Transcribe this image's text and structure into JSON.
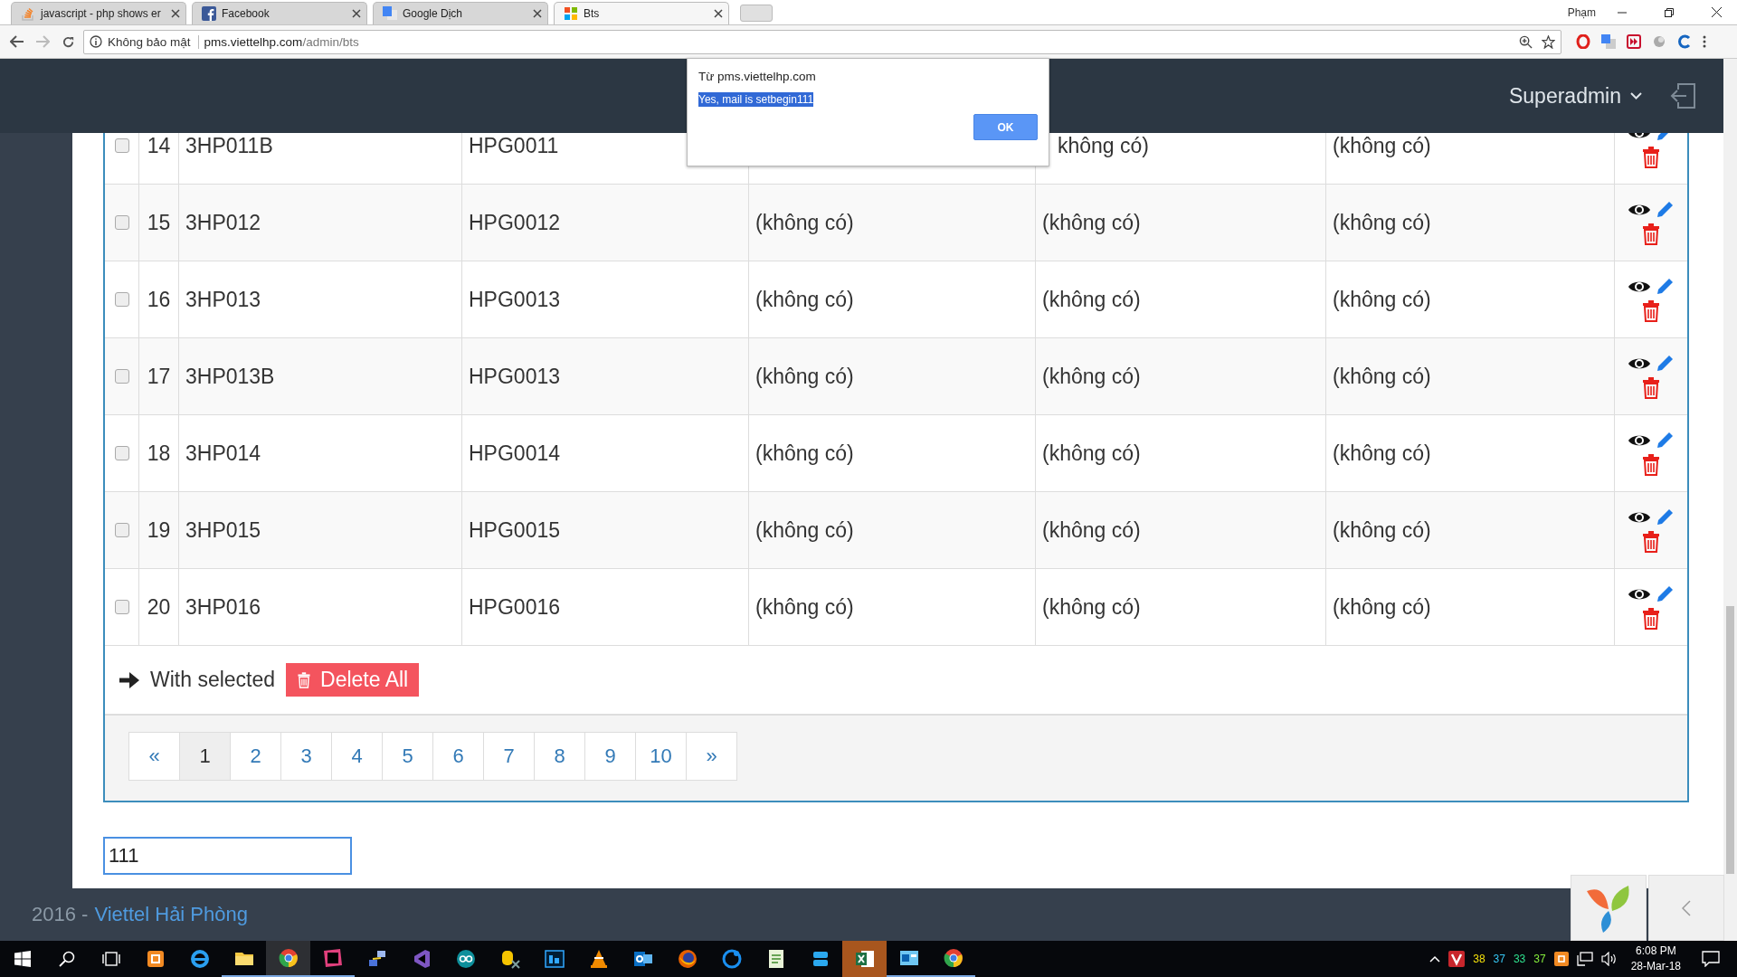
{
  "browser": {
    "tabs": [
      {
        "title": "javascript - php shows er",
        "selected": false
      },
      {
        "title": "Facebook",
        "selected": false
      },
      {
        "title": "Google Dịch",
        "selected": false
      },
      {
        "title": "Bts",
        "selected": true
      }
    ],
    "profile": "Phạm",
    "security_label": "Không bảo mật",
    "url_host": "pms.viettelhp.com",
    "url_path": "/admin/bts"
  },
  "header": {
    "user": "Superadmin"
  },
  "dialog": {
    "origin": "Từ pms.viettelhp.com",
    "message": "Yes, mail is setbegin111",
    "message_highlighted": true,
    "button": "OK"
  },
  "table": {
    "rows": [
      {
        "checked": false,
        "number": "14",
        "code": "3HP011B",
        "bts_code": "HPG0011",
        "column_5": "không có)",
        "column_6": "(không có)"
      },
      {
        "checked": false,
        "number": "15",
        "code": "3HP012",
        "bts_code": "HPG0012",
        "column_4": "(không có)",
        "column_5": "(không có)",
        "column_6": "(không có)"
      },
      {
        "checked": false,
        "number": "16",
        "code": "3HP013",
        "bts_code": "HPG0013",
        "column_4": "(không có)",
        "column_5": "(không có)",
        "column_6": "(không có)"
      },
      {
        "checked": false,
        "number": "17",
        "code": "3HP013B",
        "bts_code": "HPG0013",
        "column_4": "(không có)",
        "column_5": "(không có)",
        "column_6": "(không có)"
      },
      {
        "checked": false,
        "number": "18",
        "code": "3HP014",
        "bts_code": "HPG0014",
        "column_4": "(không có)",
        "column_5": "(không có)",
        "column_6": "(không có)"
      },
      {
        "checked": false,
        "number": "19",
        "code": "3HP015",
        "bts_code": "HPG0015",
        "column_4": "(không có)",
        "column_5": "(không có)",
        "column_6": "(không có)"
      },
      {
        "checked": false,
        "number": "20",
        "code": "3HP016",
        "bts_code": "HPG0016",
        "column_4": "(không có)",
        "column_5": "(không có)",
        "column_6": "(không có)"
      }
    ],
    "bulk": {
      "label": "With selected",
      "button": "Delete All"
    },
    "pagination": {
      "prev": "«",
      "next": "»",
      "pages": [
        {
          "label": "1",
          "selected": true
        },
        {
          "label": "2",
          "selected": false
        },
        {
          "label": "3",
          "selected": false
        },
        {
          "label": "4",
          "selected": false
        },
        {
          "label": "5",
          "selected": false
        },
        {
          "label": "6",
          "selected": false
        },
        {
          "label": "7",
          "selected": false
        },
        {
          "label": "8",
          "selected": false
        },
        {
          "label": "9",
          "selected": false
        },
        {
          "label": "10",
          "selected": false
        }
      ]
    }
  },
  "input": {
    "value": "111"
  },
  "footer": {
    "year": "2016 -",
    "link": "Viettel Hải Phòng"
  },
  "taskbar": {
    "apps": [
      {
        "kind": "xampp",
        "running": false,
        "selected": false,
        "flashing": false
      },
      {
        "kind": "ie",
        "running": false,
        "selected": false,
        "flashing": false
      },
      {
        "kind": "folder",
        "running": true,
        "selected": false,
        "flashing": false
      },
      {
        "kind": "chrome",
        "running": true,
        "selected": true,
        "flashing": false
      },
      {
        "kind": "ide",
        "running": true,
        "selected": false,
        "flashing": false
      },
      {
        "kind": "network",
        "running": false,
        "selected": false,
        "flashing": false
      },
      {
        "kind": "vs",
        "running": false,
        "selected": false,
        "flashing": false
      },
      {
        "kind": "arduino",
        "running": false,
        "selected": false,
        "flashing": false
      },
      {
        "kind": "database",
        "running": false,
        "selected": false,
        "flashing": false
      },
      {
        "kind": "photo",
        "running": false,
        "selected": false,
        "flashing": false
      },
      {
        "kind": "cone",
        "running": false,
        "selected": false,
        "flashing": false
      },
      {
        "kind": "mail",
        "running": false,
        "selected": false,
        "flashing": false
      },
      {
        "kind": "firefox",
        "running": false,
        "selected": false,
        "flashing": false
      },
      {
        "kind": "circle",
        "running": false,
        "selected": false,
        "flashing": false
      },
      {
        "kind": "notepad",
        "running": false,
        "selected": false,
        "flashing": false
      },
      {
        "kind": "tv",
        "running": false,
        "selected": false,
        "flashing": false
      },
      {
        "kind": "sheet",
        "running": false,
        "selected": false,
        "flashing": true
      },
      {
        "kind": "window",
        "running": true,
        "selected": false,
        "flashing": false
      },
      {
        "kind": "chrome",
        "running": true,
        "selected": false,
        "flashing": false
      }
    ],
    "tray_counters": [
      {
        "text": "38",
        "color": "#f5e10a"
      },
      {
        "text": "37",
        "color": "#36c6f4"
      },
      {
        "text": "33",
        "color": "#2fe08e"
      },
      {
        "text": "37",
        "color": "#86ee3c"
      }
    ],
    "time": "6:08 PM",
    "date": "28-Mar-18"
  }
}
